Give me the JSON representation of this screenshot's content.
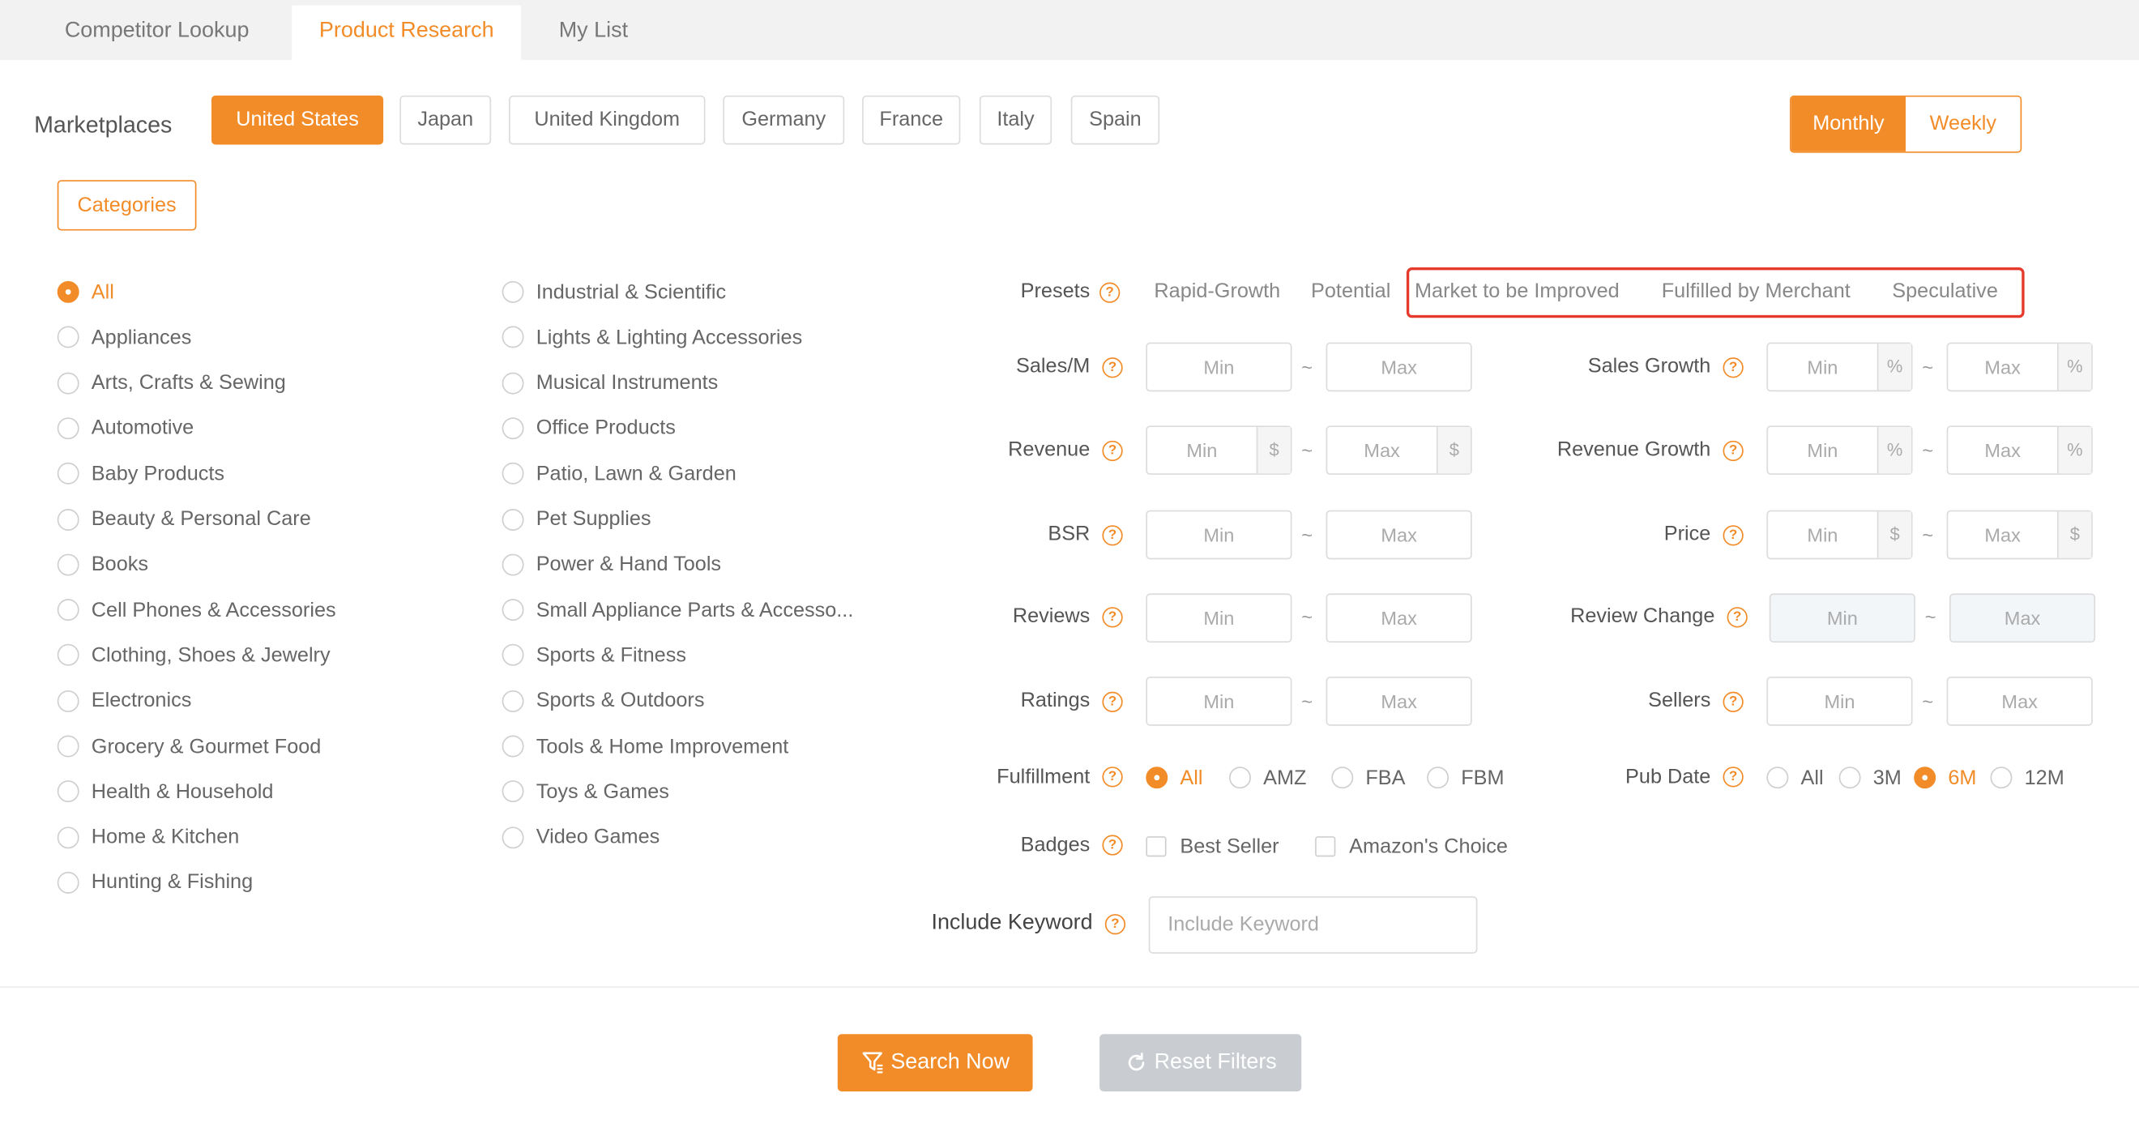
{
  "tabs": [
    "Competitor Lookup",
    "Product Research",
    "My List"
  ],
  "marketplaces": {
    "label": "Marketplaces",
    "items": [
      "United States",
      "Japan",
      "United Kingdom",
      "Germany",
      "France",
      "Italy",
      "Spain"
    ],
    "selected": "United States"
  },
  "period_toggle": {
    "monthly": "Monthly",
    "weekly": "Weekly",
    "selected": "Monthly"
  },
  "categories_button": "Categories",
  "categories_col1": [
    "All",
    "Appliances",
    "Arts, Crafts & Sewing",
    "Automotive",
    "Baby Products",
    "Beauty & Personal Care",
    "Books",
    "Cell Phones & Accessories",
    "Clothing, Shoes & Jewelry",
    "Electronics",
    "Grocery & Gourmet Food",
    "Health & Household",
    "Home & Kitchen",
    "Hunting & Fishing"
  ],
  "categories_col2": [
    "Industrial & Scientific",
    "Lights & Lighting Accessories",
    "Musical Instruments",
    "Office Products",
    "Patio, Lawn & Garden",
    "Pet Supplies",
    "Power & Hand Tools",
    "Small Appliance Parts & Accesso...",
    "Sports & Fitness",
    "Sports & Outdoors",
    "Tools & Home Improvement",
    "Toys & Games",
    "Video Games"
  ],
  "presets": {
    "label": "Presets",
    "items": [
      "Rapid-Growth",
      "Potential",
      "Market to be Improved",
      "Fulfilled by Merchant",
      "Speculative"
    ]
  },
  "filters": {
    "min": "Min",
    "max": "Max",
    "tilde": "~",
    "pct": "%",
    "usd": "$",
    "sales_m": "Sales/M",
    "revenue": "Revenue",
    "bsr": "BSR",
    "reviews": "Reviews",
    "ratings": "Ratings",
    "sales_growth": "Sales Growth",
    "revenue_growth": "Revenue Growth",
    "price": "Price",
    "review_change": "Review Change",
    "sellers": "Sellers"
  },
  "fulfillment": {
    "label": "Fulfillment",
    "options": [
      "All",
      "AMZ",
      "FBA",
      "FBM"
    ],
    "selected": "All"
  },
  "pub_date": {
    "label": "Pub Date",
    "options": [
      "All",
      "3M",
      "6M",
      "12M"
    ],
    "selected": "6M"
  },
  "badges": {
    "label": "Badges",
    "options": [
      "Best Seller",
      "Amazon's Choice"
    ]
  },
  "include_keyword": {
    "label": "Include Keyword",
    "placeholder": "Include Keyword"
  },
  "actions": {
    "search": "Search Now",
    "reset": "Reset Filters"
  },
  "help_glyph": "?",
  "colors": {
    "accent": "#f28c28",
    "highlight": "#e53a2c",
    "disabled_button": "#c9cdd2"
  },
  "icons": {
    "search": "filter-search-icon",
    "reset": "refresh-icon",
    "help": "question-circle-icon"
  }
}
